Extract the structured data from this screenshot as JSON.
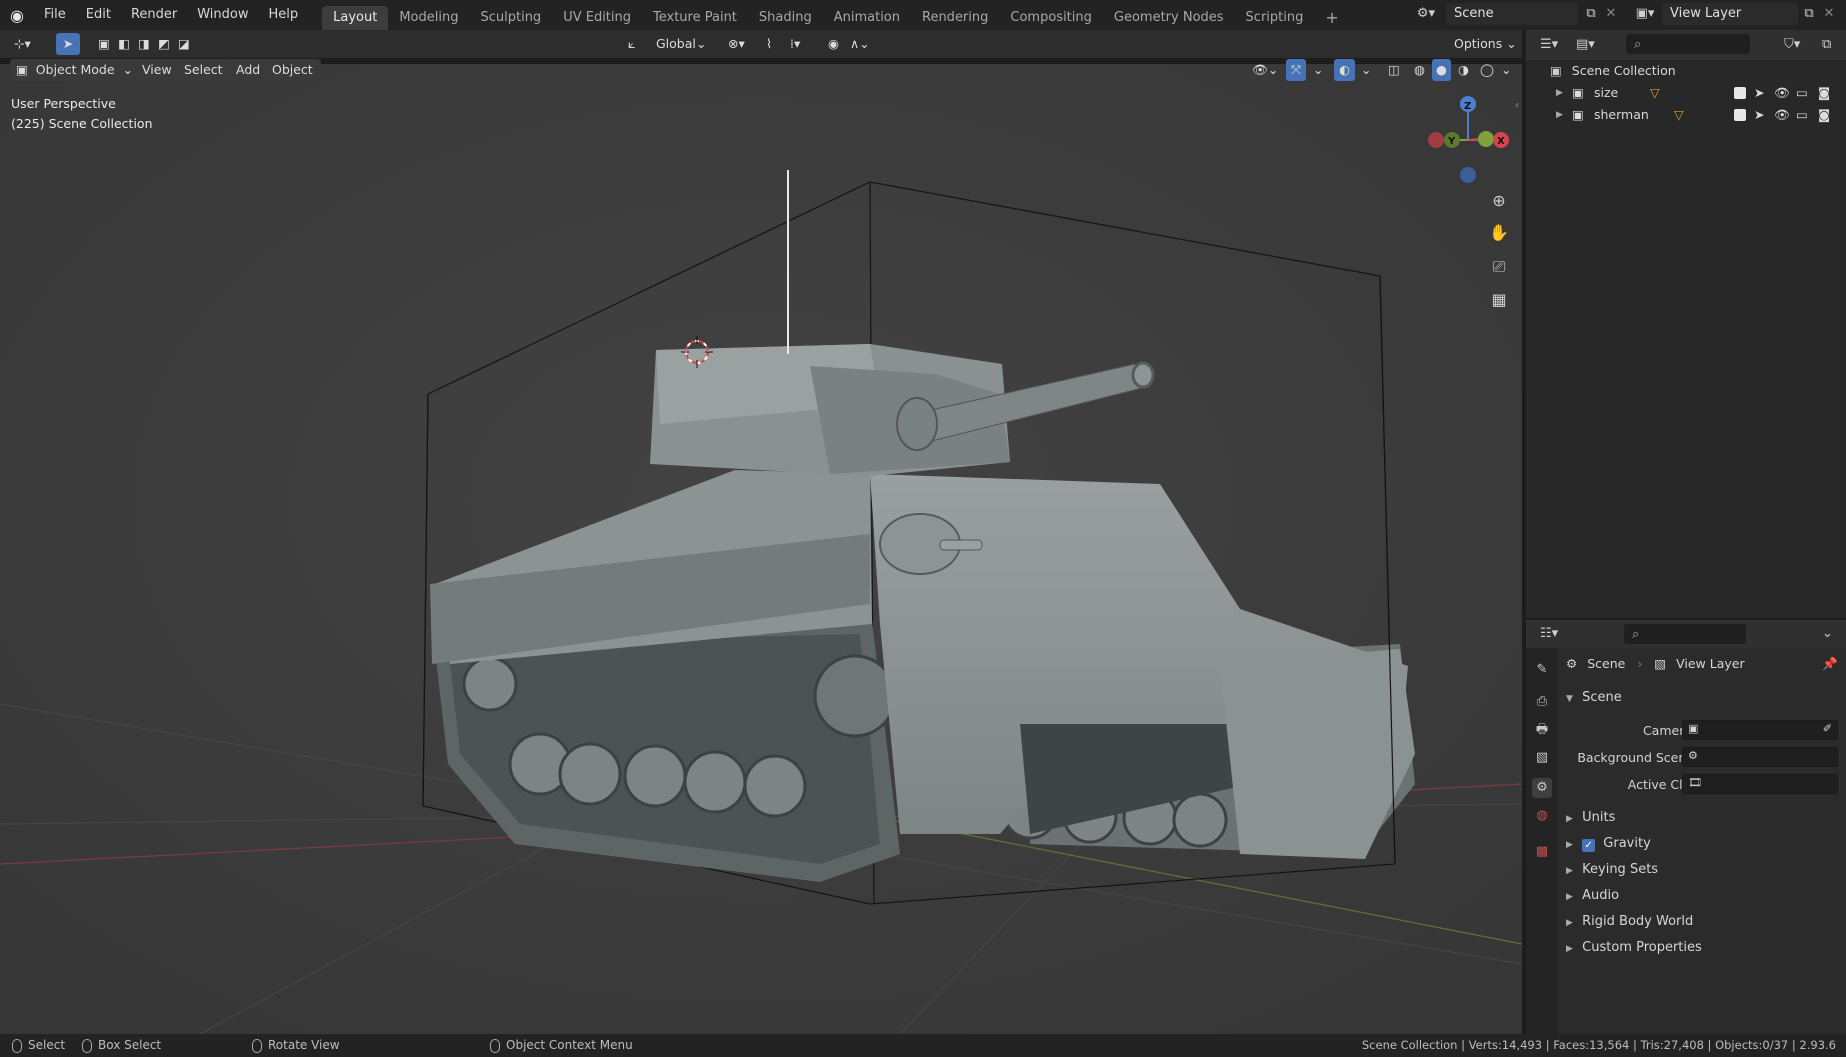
{
  "topbar": {
    "menus": [
      "File",
      "Edit",
      "Render",
      "Window",
      "Help"
    ],
    "workspaces": [
      "Layout",
      "Modeling",
      "Sculpting",
      "UV Editing",
      "Texture Paint",
      "Shading",
      "Animation",
      "Rendering",
      "Compositing",
      "Geometry Nodes",
      "Scripting"
    ],
    "active_workspace": "Layout",
    "add_tab": "+",
    "scene_name": "Scene",
    "view_layer": "View Layer"
  },
  "tool_header": {
    "orientation": "Global",
    "options_label": "Options"
  },
  "viewport_header": {
    "mode": "Object Mode",
    "menus": [
      "View",
      "Select",
      "Add",
      "Object"
    ]
  },
  "viewport": {
    "perspective_label": "User Perspective",
    "collection_label": "(225) Scene Collection",
    "gizmo_axes": {
      "x": "X",
      "y": "Y",
      "z": "Z"
    }
  },
  "outliner": {
    "root": "Scene Collection",
    "items": [
      {
        "name": "size"
      },
      {
        "name": "sherman"
      }
    ]
  },
  "properties": {
    "breadcrumb_scene": "Scene",
    "breadcrumb_layer": "View Layer",
    "section": "Scene",
    "fields": {
      "camera": "Camera",
      "background_scene": "Background Scene",
      "active_clip": "Active Clip"
    },
    "panels": [
      "Units",
      "Gravity",
      "Keying Sets",
      "Audio",
      "Rigid Body World",
      "Custom Properties"
    ],
    "gravity_checked": true
  },
  "statusbar": {
    "select": "Select",
    "box_select": "Box Select",
    "rotate_view": "Rotate View",
    "context_menu": "Object Context Menu",
    "stats": "Scene Collection | Verts:14,493 | Faces:13,564 | Tris:27,408 | Objects:0/37 | 2.93.6"
  },
  "colors": {
    "accent_blue": "#4772b3",
    "axis_x": "#d9434d",
    "axis_y": "#7ea33a",
    "axis_z": "#4d7fd1",
    "orange": "#e59a2f"
  }
}
